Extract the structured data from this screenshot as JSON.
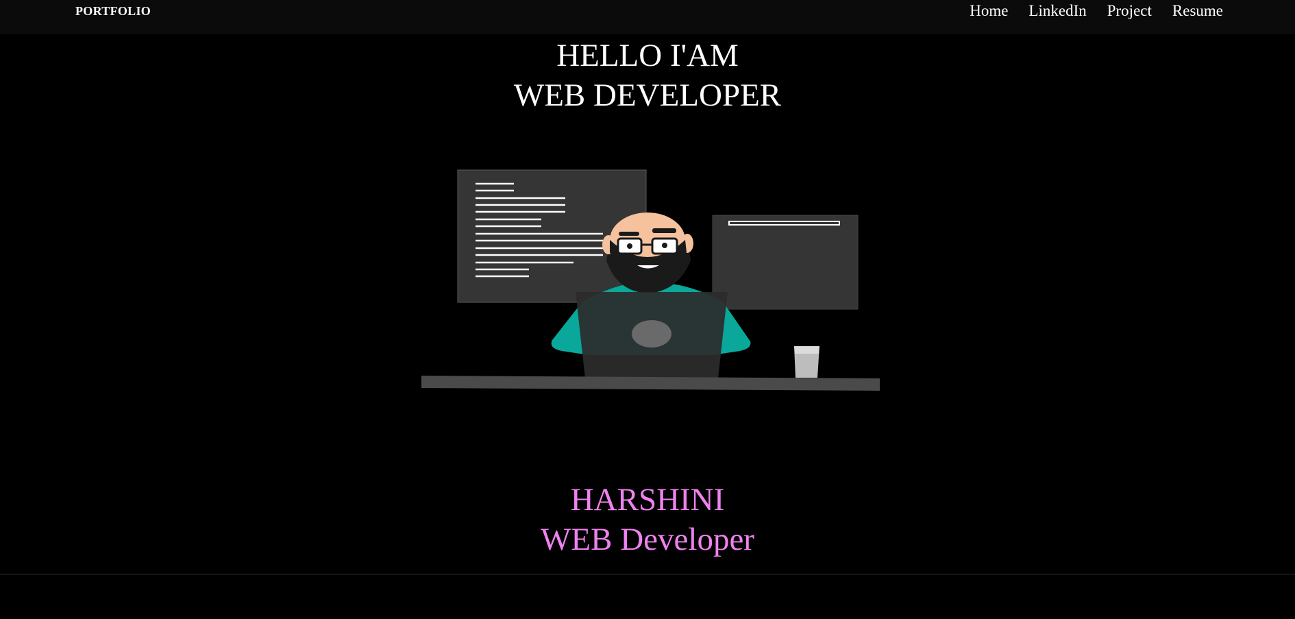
{
  "navbar": {
    "brand": "PORTFOLIO",
    "links": [
      "Home",
      "LinkedIn",
      "Project",
      "Resume"
    ]
  },
  "hero": {
    "line1": "HELLO I'AM",
    "line2": "WEB DEVELOPER"
  },
  "identity": {
    "name": "HARSHINI",
    "role": "WEB Developer"
  },
  "colors": {
    "background": "#000000",
    "navbar": "#0b0b0b",
    "text": "#ffffff",
    "accent": "#ee82ee",
    "shirt": "#0aa89a"
  },
  "illustration": {
    "icon": "developer-at-desk-illustration"
  }
}
